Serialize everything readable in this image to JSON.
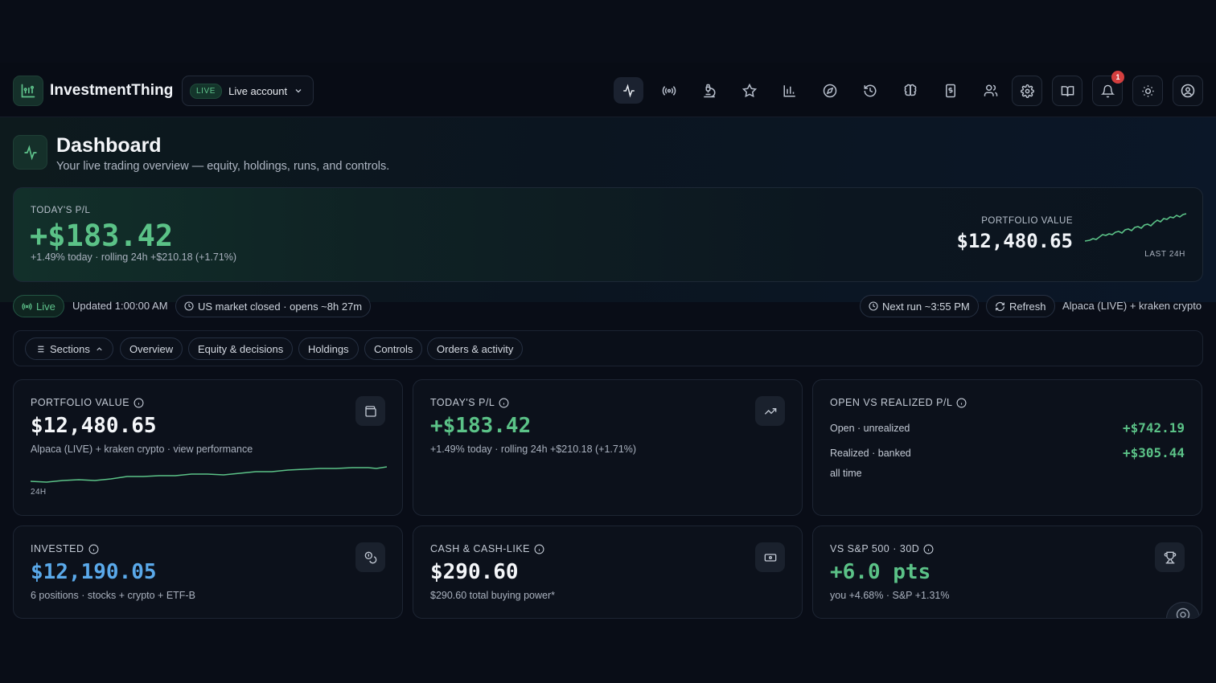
{
  "app": {
    "name": "InvestmentThing"
  },
  "account": {
    "badge": "LIVE",
    "label": "Live account"
  },
  "nav": {
    "icons": [
      "activity-icon",
      "broadcast-icon",
      "microscope-icon",
      "star-icon",
      "bar-chart-icon",
      "compass-icon",
      "history-icon",
      "brain-icon",
      "receipt-dollar-icon",
      "users-icon"
    ],
    "right_buttons": [
      "settings-icon",
      "book-open-icon",
      "bell-icon",
      "sun-icon",
      "user-circle-icon"
    ],
    "notification_count": "1"
  },
  "page": {
    "title": "Dashboard",
    "subtitle": "Your live trading overview — equity, holdings, runs, and controls."
  },
  "hero": {
    "pl_label": "TODAY'S P/L",
    "pl_value": "+$183.42",
    "pl_sub": "+1.49% today · rolling 24h +$210.18 (+1.71%)",
    "pv_label": "PORTFOLIO VALUE",
    "pv_value": "$12,480.65",
    "pv_period": "LAST 24H"
  },
  "status": {
    "live": "Live",
    "updated": "Updated 1:00:00 AM",
    "market": "US market closed · opens ~8h 27m",
    "next_run": "Next run ~3:55 PM",
    "refresh": "Refresh",
    "brokers": "Alpaca (LIVE) + kraken crypto"
  },
  "sections": {
    "toggle": "Sections",
    "links": [
      "Overview",
      "Equity & decisions",
      "Holdings",
      "Controls",
      "Orders & activity"
    ]
  },
  "cards": {
    "portfolio": {
      "label": "PORTFOLIO VALUE",
      "value": "$12,480.65",
      "sub": "Alpaca (LIVE) + kraken crypto · view performance",
      "spark_label": "24H",
      "icon": "wallet-icon"
    },
    "today_pl": {
      "label": "TODAY'S P/L",
      "value": "+$183.42",
      "sub": "+1.49% today · rolling 24h +$210.18 (+1.71%)",
      "icon": "trending-up-icon"
    },
    "open_realized": {
      "label": "OPEN VS REALIZED P/L",
      "open_label": "Open · unrealized",
      "open_value": "+$742.19",
      "realized_label": "Realized · banked",
      "realized_value": "+$305.44",
      "period": "all time"
    },
    "invested": {
      "label": "INVESTED",
      "value": "$12,190.05",
      "sub": "6 positions · stocks + crypto + ETF-B",
      "icon": "coins-icon"
    },
    "cash": {
      "label": "CASH & CASH-LIKE",
      "value": "$290.60",
      "sub": "$290.60 total buying power*",
      "icon": "banknote-icon"
    },
    "vs_sp": {
      "label": "VS S&P 500 · 30D",
      "value": "+6.0 pts",
      "sub": "you +4.68% · S&P +1.31%",
      "icon": "trophy-icon"
    }
  },
  "colors": {
    "accent_green": "#5bc287",
    "accent_blue": "#5aa9ea",
    "badge_red": "#d43f3f",
    "background": "#090d17"
  }
}
